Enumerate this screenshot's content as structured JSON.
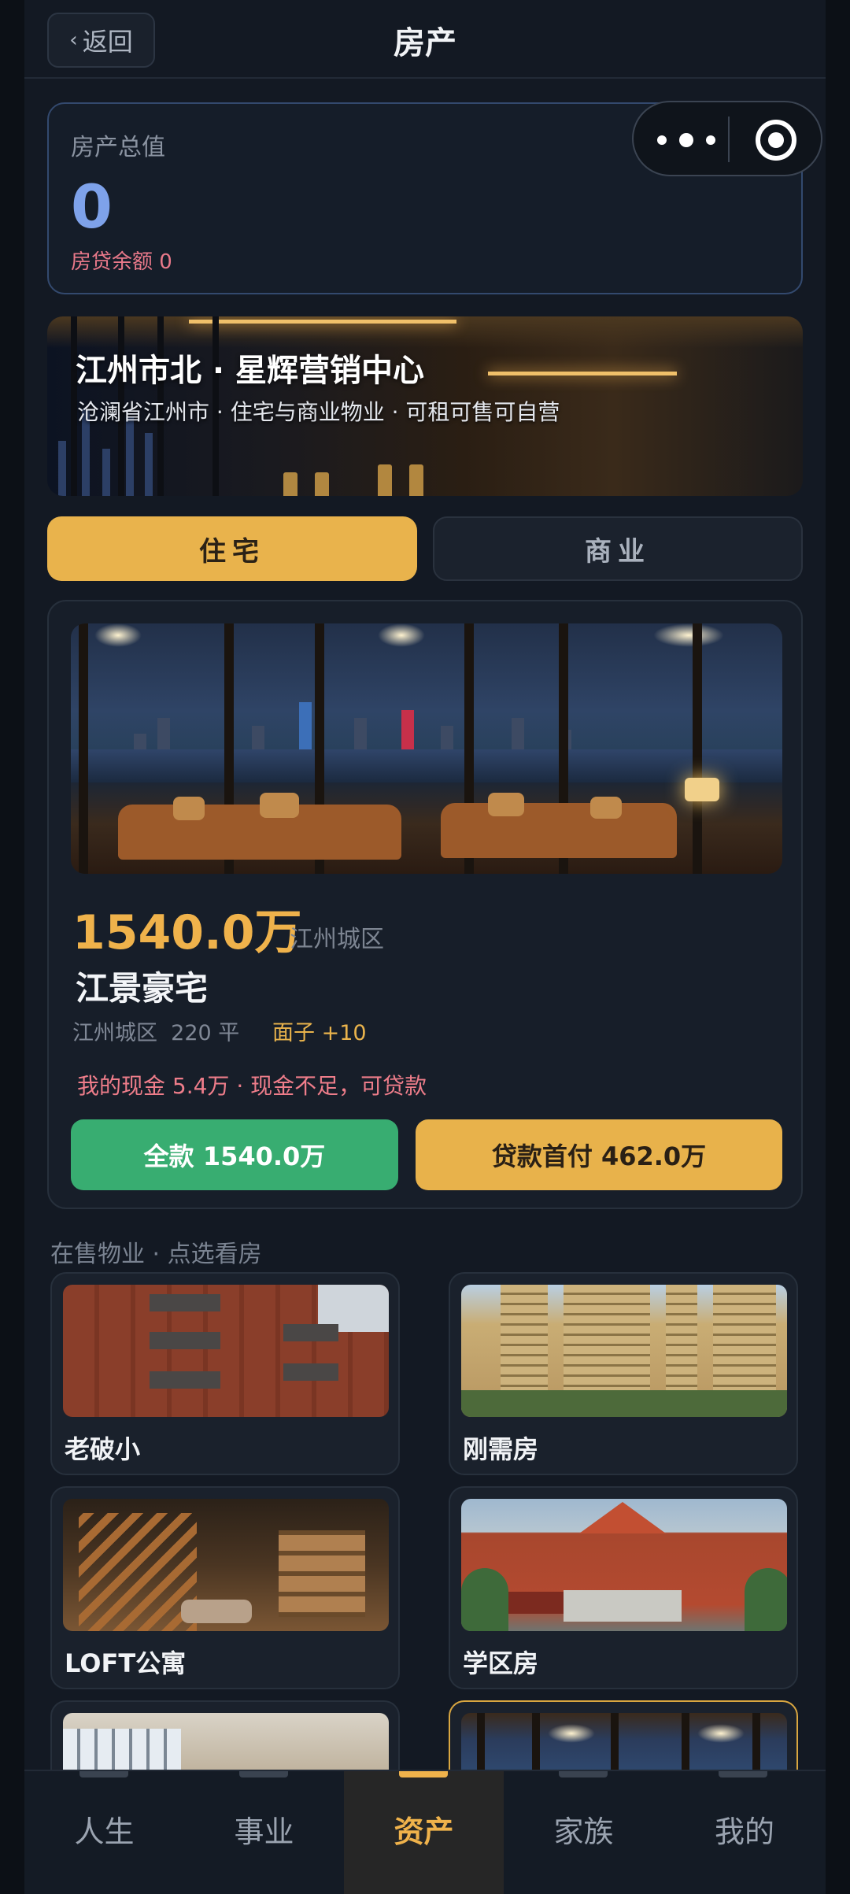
{
  "header": {
    "back_label": "返回",
    "title": "房产"
  },
  "summary": {
    "total_label": "房产总值",
    "total_value": "0",
    "loan_balance": "房贷余额 0"
  },
  "banner": {
    "title": "江州市北 · 星辉营销中心",
    "subtitle": "沧澜省江州市 · 住宅与商业物业 · 可租可售可自营"
  },
  "tabs": [
    {
      "label": "住宅",
      "active": true
    },
    {
      "label": "商业",
      "active": false
    }
  ],
  "featured": {
    "price": "1540.0万",
    "district": "江州城区",
    "name": "江景豪宅",
    "detail": "江州城区  220 平",
    "face": "面子 +10",
    "cash_note": "我的现金 5.4万 · 现金不足，可贷款",
    "buy_full_label": "全款 1540.0万",
    "buy_loan_label": "贷款首付 462.0万"
  },
  "listing": {
    "section_title": "在售物业 · 点选看房",
    "items": [
      {
        "label": "老破小"
      },
      {
        "label": "刚需房"
      },
      {
        "label": "LOFT公寓"
      },
      {
        "label": "学区房"
      }
    ]
  },
  "nav": [
    {
      "label": "人生"
    },
    {
      "label": "事业"
    },
    {
      "label": "资产",
      "active": true
    },
    {
      "label": "家族"
    },
    {
      "label": "我的"
    }
  ],
  "colors": {
    "accent": "#efb24b",
    "primary_value": "#7ea2ea",
    "danger": "#ee7d8a",
    "buy_full": "#38ad71"
  }
}
